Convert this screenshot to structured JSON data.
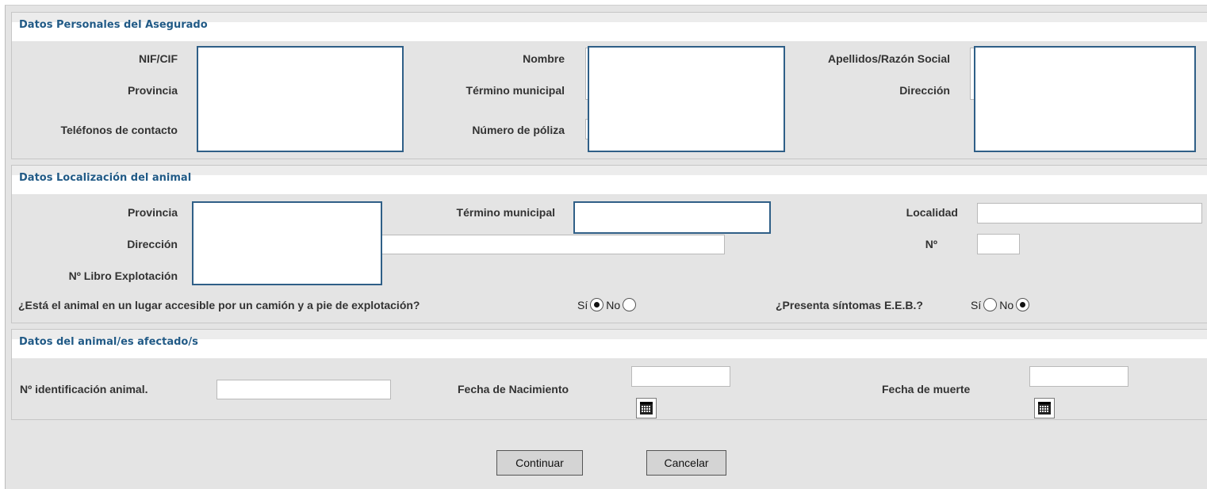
{
  "sections": {
    "personal": {
      "title": "Datos Personales del Asegurado",
      "labels": {
        "nif": "NIF/CIF",
        "nombre": "Nombre",
        "apellidos": "Apellidos/Razón Social",
        "provincia": "Provincia",
        "termino": "Término municipal",
        "direccion": "Dirección",
        "telefonos": "Teléfonos de contacto",
        "poliza": "Número de póliza"
      }
    },
    "location": {
      "title": "Datos Localización del animal",
      "labels": {
        "provincia": "Provincia",
        "termino": "Término municipal",
        "localidad": "Localidad",
        "direccion": "Dirección",
        "numero": "Nº",
        "libro": "Nº Libro Explotación"
      },
      "q_accesible": "¿Está el animal en un lugar accesible por un camión y a pie de explotación?",
      "q_sintomas": "¿Presenta síntomas E.E.B.?",
      "radio_si": "Sí",
      "radio_no": "No",
      "accesible_selected": "Sí",
      "sintomas_selected": "No"
    },
    "animal": {
      "title": "Datos del animal/es afectado/s",
      "labels": {
        "identificacion": "Nº identificación animal.",
        "nacimiento": "Fecha de Nacimiento",
        "muerte": "Fecha de muerte"
      }
    }
  },
  "buttons": {
    "continuar": "Continuar",
    "cancelar": "Cancelar"
  },
  "icons": {
    "calendar": "calendar-icon"
  }
}
